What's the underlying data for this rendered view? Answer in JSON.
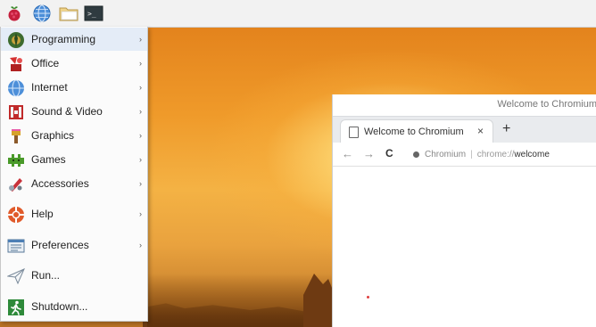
{
  "panel": {
    "icons": [
      "raspberry-icon",
      "globe-icon",
      "folder-icon",
      "terminal-icon"
    ],
    "terminal_glyph": ">_"
  },
  "menu": {
    "items": [
      {
        "label": "Programming",
        "icon": "programming-icon",
        "submenu": true
      },
      {
        "label": "Office",
        "icon": "office-icon",
        "submenu": true
      },
      {
        "label": "Internet",
        "icon": "internet-icon",
        "submenu": true
      },
      {
        "label": "Sound & Video",
        "icon": "sound-video-icon",
        "submenu": true
      },
      {
        "label": "Graphics",
        "icon": "graphics-icon",
        "submenu": true
      },
      {
        "label": "Games",
        "icon": "games-icon",
        "submenu": true
      },
      {
        "label": "Accessories",
        "icon": "accessories-icon",
        "submenu": true
      },
      {
        "label": "Help",
        "icon": "help-icon",
        "submenu": true
      },
      {
        "label": "Preferences",
        "icon": "preferences-icon",
        "submenu": true
      },
      {
        "label": "Run...",
        "icon": "run-icon",
        "submenu": false
      },
      {
        "label": "Shutdown...",
        "icon": "shutdown-icon",
        "submenu": false
      }
    ],
    "arrow_glyph": "›"
  },
  "browser": {
    "window_title": "Welcome to Chromium",
    "tab_title": "Welcome to Chromium",
    "tab_close": "×",
    "new_tab": "+",
    "back": "←",
    "forward": "→",
    "reload": "C",
    "omnibox": {
      "site": "Chromium",
      "scheme": "chrome://",
      "path": "welcome"
    }
  },
  "colors": {
    "panel_bg": "#f2f2f2",
    "menu_bg": "#fbfbfb",
    "desktop_orange": "#e08a20"
  }
}
